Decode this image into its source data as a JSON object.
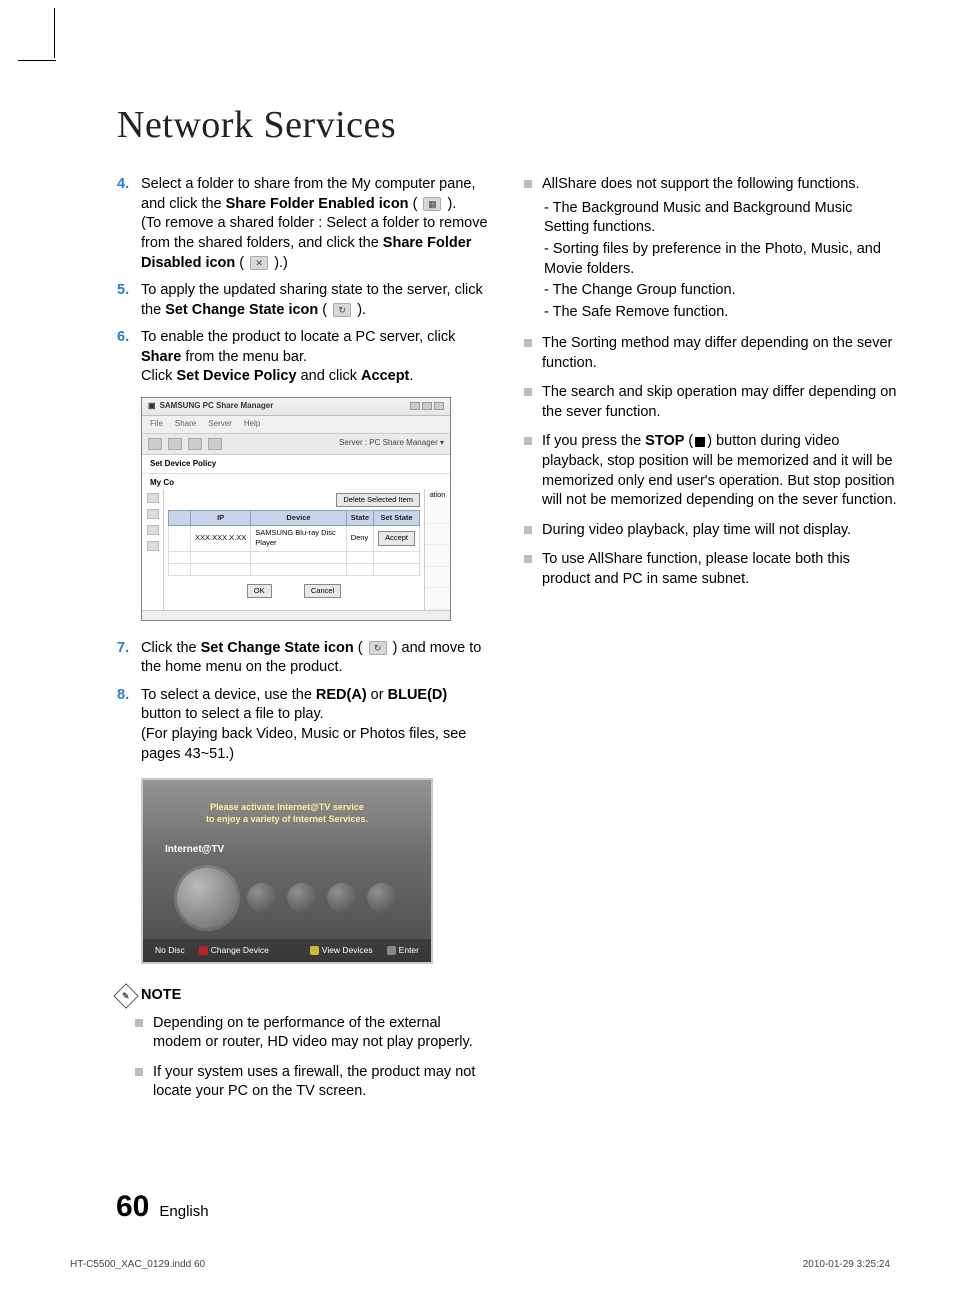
{
  "page_title": "Network Services",
  "steps": {
    "s4": {
      "num": "4",
      "l1a": "Select a folder to share from the My computer pane, and click the ",
      "l1b": "Share Folder Enabled icon",
      "l1c": " ( ",
      "l1d": " ).",
      "l2a": "(To remove a shared folder : Select a folder to remove from the shared folders, and click the ",
      "l2b": "Share Folder Disabled icon",
      "l2c": " ( ",
      "l2d": " ).)"
    },
    "s5": {
      "num": "5",
      "a": "To apply the updated sharing state to the server, click the ",
      "b": "Set Change State icon",
      "c": " ( ",
      "d": " )."
    },
    "s6": {
      "num": "6",
      "a": "To enable the product to locate a PC server, click ",
      "b": "Share",
      "c": " from the menu bar.",
      "d": "Click ",
      "e": "Set Device Policy",
      "f": " and click ",
      "g": "Accept",
      "h": "."
    },
    "s7": {
      "num": "7",
      "a": "Click the ",
      "b": "Set Change State icon",
      "c": " ( ",
      "d": " ) and move to the home menu on the product."
    },
    "s8": {
      "num": "8",
      "a": "To select a device, use the ",
      "b": "RED(A)",
      "c": " or ",
      "d": "BLUE(D)",
      "e": " button to select a file to play.",
      "f": "(For playing back Video, Music or Photos files, see pages 43~51.)"
    }
  },
  "fig1": {
    "title": "SAMSUNG PC Share Manager",
    "menu": [
      "File",
      "Share",
      "Server",
      "Help"
    ],
    "server_label": "Server : PC Share Manager  ▾",
    "set_policy": "Set Device Policy",
    "myco": "My Co",
    "delete_btn": "Delete Selected Item",
    "cols": [
      "IP",
      "Device",
      "State",
      "Set State"
    ],
    "row": {
      "ip": "XXX.XXX.X.XX",
      "device": "SAMSUNG Blu-ray Disc Player",
      "state": "Deny",
      "accept": "Accept"
    },
    "side_label": "ation",
    "ok": "OK",
    "cancel": "Cancel"
  },
  "fig2": {
    "msg1": "Please activate Internet@TV service",
    "msg2": "to enjoy a variety of Internet Services.",
    "label": "Internet@TV",
    "bottom": {
      "nodisc": "No Disc",
      "change": "Change Device",
      "view": "View Devices",
      "enter": "Enter"
    }
  },
  "note_hdr": "NOTE",
  "notes_left": [
    "Depending on te performance of the external modem or router, HD video may not play properly.",
    "If your system uses a firewall, the product may not locate your PC on the TV screen."
  ],
  "notes_right": [
    {
      "text": "AllShare does not support the following functions.",
      "sub": [
        "- The Background Music and Background Music Setting functions.",
        "- Sorting files by preference in the Photo, Music, and Movie folders.",
        "- The Change Group function.",
        "- The Safe Remove function."
      ]
    },
    {
      "text": "The Sorting method may differ depending on the sever function."
    },
    {
      "text": "The search and skip operation may differ depending on the sever function."
    },
    {
      "pre": "If you press the ",
      "bold": "STOP",
      "mid": " (",
      "post": ") button during video playback, stop position will be memorized and it will be memorized only end user's operation. But stop position will not be memorized depending on the sever function."
    },
    {
      "text": "During video playback, play time will not display."
    },
    {
      "text": "To use AllShare function, please locate both this product and PC in same subnet."
    }
  ],
  "footer": {
    "page": "60",
    "lang": "English",
    "file": "HT-C5500_XAC_0129.indd   60",
    "date": "2010-01-29   3:25:24"
  }
}
